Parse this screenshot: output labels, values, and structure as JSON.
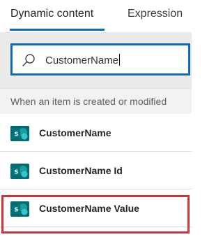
{
  "tabs": [
    {
      "label": "Dynamic content",
      "active": true
    },
    {
      "label": "Expression",
      "active": false
    }
  ],
  "search": {
    "value": "CustomerName",
    "icon": "search-icon"
  },
  "section": {
    "title": "When an item is created or modified"
  },
  "items": [
    {
      "label": "CustomerName",
      "icon": "sharepoint-icon"
    },
    {
      "label": "CustomerName Id",
      "icon": "sharepoint-icon"
    },
    {
      "label": "CustomerName Value",
      "icon": "sharepoint-icon",
      "highlighted": true
    }
  ],
  "colors": {
    "accent": "#0f6cbd",
    "sharepoint": "#036c70",
    "highlight": "#d13438"
  }
}
